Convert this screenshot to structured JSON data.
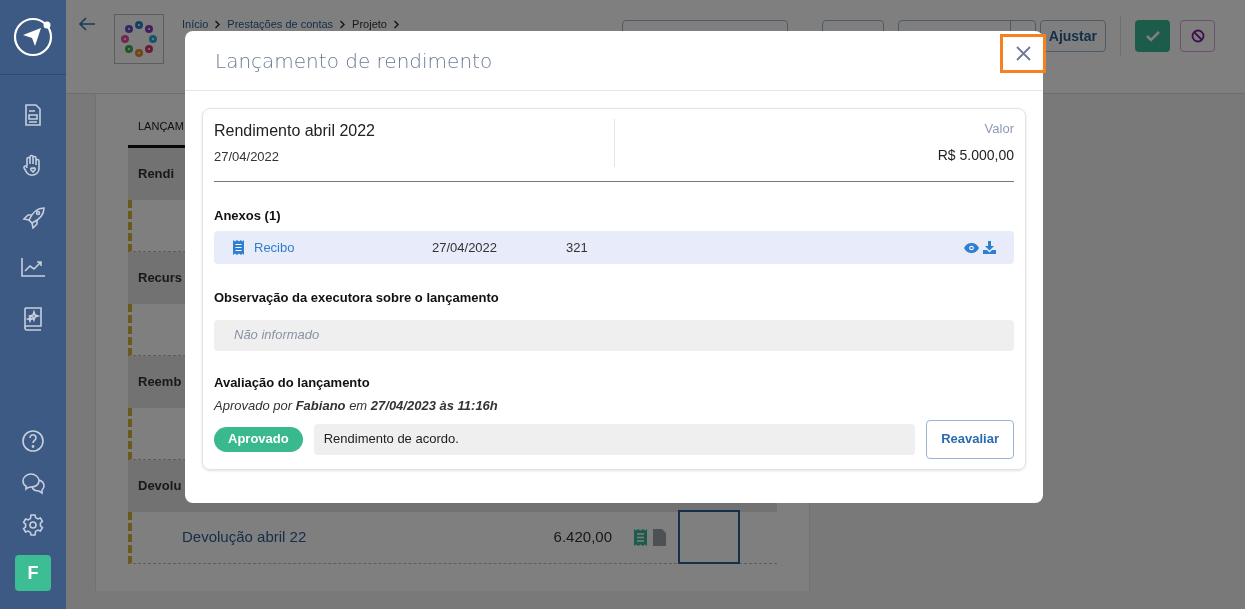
{
  "sidebar": {
    "avatar": "F"
  },
  "header": {
    "breadcrumbs": [
      {
        "label": "Início",
        "link": true
      },
      {
        "label": "Prestações de contas",
        "link": true
      },
      {
        "label": "Projeto",
        "link": false
      }
    ],
    "adjust_button": "Ajustar"
  },
  "tabs": [
    {
      "label": "LANÇAM",
      "selected": true
    }
  ],
  "groups": [
    {
      "title": "Rendi"
    },
    {
      "title": "Recurs"
    },
    {
      "title": "Reemb"
    },
    {
      "title": "Devolu",
      "rows": [
        {
          "name": "Devolução abril 22",
          "value": "6.420,00"
        }
      ]
    }
  ],
  "modal": {
    "title": "Lançamento de rendimento",
    "entry": {
      "name": "Rendimento abril 2022",
      "date": "27/04/2022",
      "value_label": "Valor",
      "value": "R$ 5.000,00"
    },
    "attachments_title": "Anexos (1)",
    "attachments": [
      {
        "name": "Recibo",
        "date": "27/04/2022",
        "number": "321"
      }
    ],
    "observation_title": "Observação da executora sobre o lançamento",
    "observation_placeholder": "Não informado",
    "evaluation_title": "Avaliação do lançamento",
    "evaluation_note": "Aprovado por **Fabiano** em **27/04/2023 às 11:16h**",
    "status": {
      "label": "Aprovado",
      "kind": "approved"
    },
    "comment": "Rendimento de acordo.",
    "reevaluate_button": "Reavaliar"
  }
}
